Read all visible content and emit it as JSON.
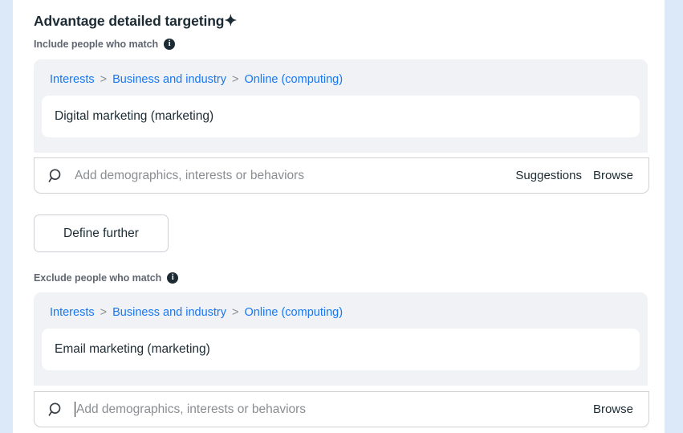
{
  "theme": {
    "edge_strip_color": "#dce9f8",
    "panel_background": "#f0f2f5",
    "link_color": "#1877f2",
    "text_color": "#1c2b33",
    "muted_text_color": "#8a8d91",
    "border_color": "#cfd1d5"
  },
  "header": {
    "title": "Advantage detailed targeting",
    "sparkle_icon": "✦"
  },
  "include": {
    "label": "Include people who match",
    "info_icon": "i",
    "breadcrumb": {
      "items": [
        "Interests",
        "Business and industry",
        "Online (computing)"
      ],
      "separator": ">"
    },
    "chip": "Digital marketing (marketing)",
    "search": {
      "placeholder": "Add demographics, interests or behaviors",
      "value": "",
      "icon": "search-icon",
      "focused": false,
      "actions": [
        "Suggestions",
        "Browse"
      ]
    }
  },
  "define_further": {
    "label": "Define further"
  },
  "exclude": {
    "label": "Exclude people who match",
    "info_icon": "i",
    "breadcrumb": {
      "items": [
        "Interests",
        "Business and industry",
        "Online (computing)"
      ],
      "separator": ">"
    },
    "chip": "Email marketing (marketing)",
    "search": {
      "placeholder": "Add demographics, interests or behaviors",
      "value": "",
      "icon": "search-icon",
      "focused": true,
      "actions": [
        "Browse"
      ]
    }
  }
}
